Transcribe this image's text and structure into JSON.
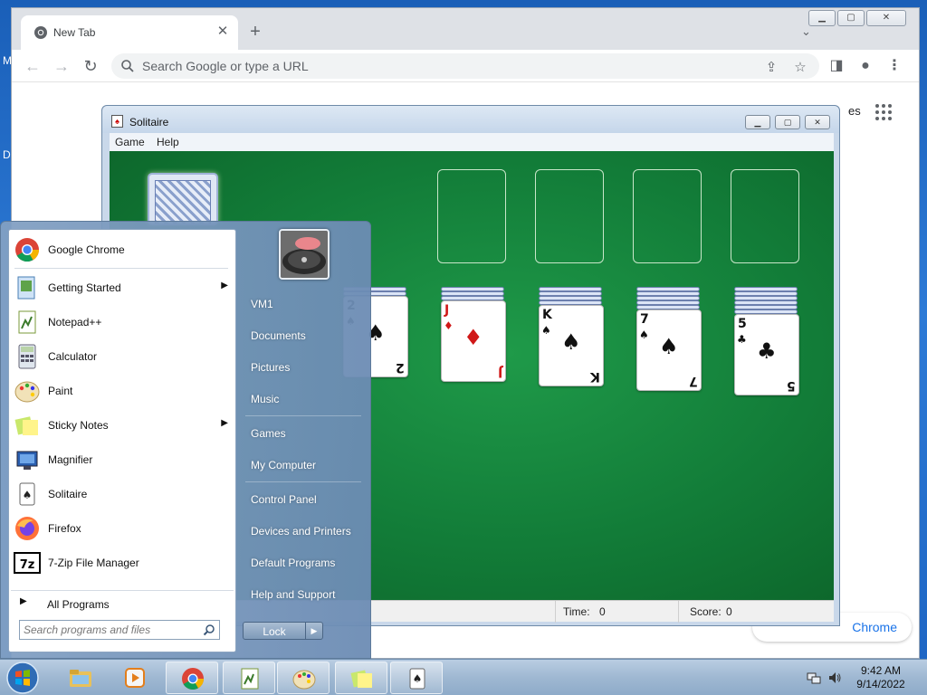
{
  "chrome": {
    "tab_title": "New Tab",
    "omnibox_placeholder": "Search Google or type a URL",
    "ntp_partial_text": "es",
    "ntp_customize_partial": "Chrome"
  },
  "desktop": {
    "frag_m": "M",
    "frag_d": "D"
  },
  "solitaire": {
    "title": "Solitaire",
    "menu": [
      "Game",
      "Help"
    ],
    "status": {
      "time_label": "Time:",
      "time_value": "0",
      "score_label": "Score:",
      "score_value": "0"
    },
    "tableau": [
      {
        "rank": "2",
        "suit": "♠",
        "color": "black"
      },
      {
        "rank": "J",
        "suit": "♦",
        "color": "red"
      },
      {
        "rank": "K",
        "suit": "♠",
        "color": "black"
      },
      {
        "rank": "7",
        "suit": "♠",
        "color": "black"
      },
      {
        "rank": "5",
        "suit": "♣",
        "color": "black"
      }
    ]
  },
  "start_menu": {
    "programs": [
      {
        "label": "Google Chrome",
        "icon": "chrome-icon",
        "submenu": false
      },
      {
        "label": "Getting Started",
        "icon": "getting-started-icon",
        "submenu": true
      },
      {
        "label": "Notepad++",
        "icon": "notepadpp-icon",
        "submenu": false
      },
      {
        "label": "Calculator",
        "icon": "calculator-icon",
        "submenu": false
      },
      {
        "label": "Paint",
        "icon": "paint-icon",
        "submenu": false
      },
      {
        "label": "Sticky Notes",
        "icon": "sticky-notes-icon",
        "submenu": true
      },
      {
        "label": "Magnifier",
        "icon": "magnifier-icon",
        "submenu": false
      },
      {
        "label": "Solitaire",
        "icon": "solitaire-icon",
        "submenu": false
      },
      {
        "label": "Firefox",
        "icon": "firefox-icon",
        "submenu": false
      },
      {
        "label": "7-Zip File Manager",
        "icon": "7zip-icon",
        "submenu": false
      }
    ],
    "all_programs": "All Programs",
    "search_placeholder": "Search programs and files",
    "right_items": [
      "VM1",
      "Documents",
      "Pictures",
      "Music",
      "Games",
      "My Computer",
      "Control Panel",
      "Devices and Printers",
      "Default Programs",
      "Help and Support"
    ],
    "lock_label": "Lock"
  },
  "taskbar": {
    "time": "9:42 AM",
    "date": "9/14/2022",
    "items": [
      "explorer",
      "media-player",
      "chrome",
      "notepadpp",
      "paint",
      "sticky-notes",
      "solitaire"
    ]
  },
  "colors": {
    "felt": "#127c38",
    "chrome_tabstrip": "#dee1e6",
    "taskbar": "#9fb8d2"
  }
}
